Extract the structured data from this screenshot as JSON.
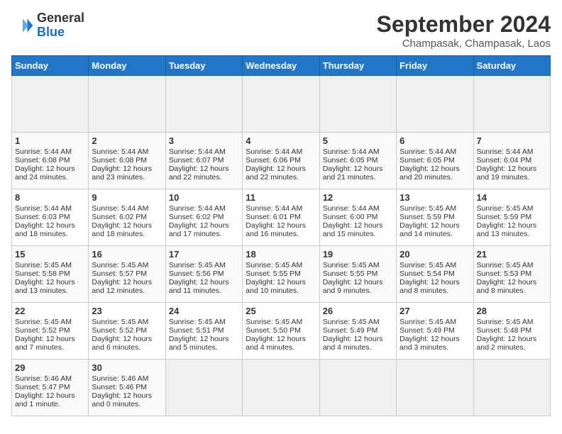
{
  "header": {
    "logo_line1": "General",
    "logo_line2": "Blue",
    "month_title": "September 2024",
    "location": "Champasak, Champasak, Laos"
  },
  "calendar": {
    "days_of_week": [
      "Sunday",
      "Monday",
      "Tuesday",
      "Wednesday",
      "Thursday",
      "Friday",
      "Saturday"
    ],
    "weeks": [
      [
        {
          "day": "",
          "empty": true
        },
        {
          "day": "",
          "empty": true
        },
        {
          "day": "",
          "empty": true
        },
        {
          "day": "",
          "empty": true
        },
        {
          "day": "",
          "empty": true
        },
        {
          "day": "",
          "empty": true
        },
        {
          "day": "",
          "empty": true
        }
      ],
      [
        {
          "day": "1",
          "sunrise": "Sunrise: 5:44 AM",
          "sunset": "Sunset: 6:08 PM",
          "daylight": "Daylight: 12 hours and 24 minutes."
        },
        {
          "day": "2",
          "sunrise": "Sunrise: 5:44 AM",
          "sunset": "Sunset: 6:08 PM",
          "daylight": "Daylight: 12 hours and 23 minutes."
        },
        {
          "day": "3",
          "sunrise": "Sunrise: 5:44 AM",
          "sunset": "Sunset: 6:07 PM",
          "daylight": "Daylight: 12 hours and 22 minutes."
        },
        {
          "day": "4",
          "sunrise": "Sunrise: 5:44 AM",
          "sunset": "Sunset: 6:06 PM",
          "daylight": "Daylight: 12 hours and 22 minutes."
        },
        {
          "day": "5",
          "sunrise": "Sunrise: 5:44 AM",
          "sunset": "Sunset: 6:05 PM",
          "daylight": "Daylight: 12 hours and 21 minutes."
        },
        {
          "day": "6",
          "sunrise": "Sunrise: 5:44 AM",
          "sunset": "Sunset: 6:05 PM",
          "daylight": "Daylight: 12 hours and 20 minutes."
        },
        {
          "day": "7",
          "sunrise": "Sunrise: 5:44 AM",
          "sunset": "Sunset: 6:04 PM",
          "daylight": "Daylight: 12 hours and 19 minutes."
        }
      ],
      [
        {
          "day": "8",
          "sunrise": "Sunrise: 5:44 AM",
          "sunset": "Sunset: 6:03 PM",
          "daylight": "Daylight: 12 hours and 18 minutes."
        },
        {
          "day": "9",
          "sunrise": "Sunrise: 5:44 AM",
          "sunset": "Sunset: 6:02 PM",
          "daylight": "Daylight: 12 hours and 18 minutes."
        },
        {
          "day": "10",
          "sunrise": "Sunrise: 5:44 AM",
          "sunset": "Sunset: 6:02 PM",
          "daylight": "Daylight: 12 hours and 17 minutes."
        },
        {
          "day": "11",
          "sunrise": "Sunrise: 5:44 AM",
          "sunset": "Sunset: 6:01 PM",
          "daylight": "Daylight: 12 hours and 16 minutes."
        },
        {
          "day": "12",
          "sunrise": "Sunrise: 5:44 AM",
          "sunset": "Sunset: 6:00 PM",
          "daylight": "Daylight: 12 hours and 15 minutes."
        },
        {
          "day": "13",
          "sunrise": "Sunrise: 5:45 AM",
          "sunset": "Sunset: 5:59 PM",
          "daylight": "Daylight: 12 hours and 14 minutes."
        },
        {
          "day": "14",
          "sunrise": "Sunrise: 5:45 AM",
          "sunset": "Sunset: 5:59 PM",
          "daylight": "Daylight: 12 hours and 13 minutes."
        }
      ],
      [
        {
          "day": "15",
          "sunrise": "Sunrise: 5:45 AM",
          "sunset": "Sunset: 5:58 PM",
          "daylight": "Daylight: 12 hours and 13 minutes."
        },
        {
          "day": "16",
          "sunrise": "Sunrise: 5:45 AM",
          "sunset": "Sunset: 5:57 PM",
          "daylight": "Daylight: 12 hours and 12 minutes."
        },
        {
          "day": "17",
          "sunrise": "Sunrise: 5:45 AM",
          "sunset": "Sunset: 5:56 PM",
          "daylight": "Daylight: 12 hours and 11 minutes."
        },
        {
          "day": "18",
          "sunrise": "Sunrise: 5:45 AM",
          "sunset": "Sunset: 5:55 PM",
          "daylight": "Daylight: 12 hours and 10 minutes."
        },
        {
          "day": "19",
          "sunrise": "Sunrise: 5:45 AM",
          "sunset": "Sunset: 5:55 PM",
          "daylight": "Daylight: 12 hours and 9 minutes."
        },
        {
          "day": "20",
          "sunrise": "Sunrise: 5:45 AM",
          "sunset": "Sunset: 5:54 PM",
          "daylight": "Daylight: 12 hours and 8 minutes."
        },
        {
          "day": "21",
          "sunrise": "Sunrise: 5:45 AM",
          "sunset": "Sunset: 5:53 PM",
          "daylight": "Daylight: 12 hours and 8 minutes."
        }
      ],
      [
        {
          "day": "22",
          "sunrise": "Sunrise: 5:45 AM",
          "sunset": "Sunset: 5:52 PM",
          "daylight": "Daylight: 12 hours and 7 minutes."
        },
        {
          "day": "23",
          "sunrise": "Sunrise: 5:45 AM",
          "sunset": "Sunset: 5:52 PM",
          "daylight": "Daylight: 12 hours and 6 minutes."
        },
        {
          "day": "24",
          "sunrise": "Sunrise: 5:45 AM",
          "sunset": "Sunset: 5:51 PM",
          "daylight": "Daylight: 12 hours and 5 minutes."
        },
        {
          "day": "25",
          "sunrise": "Sunrise: 5:45 AM",
          "sunset": "Sunset: 5:50 PM",
          "daylight": "Daylight: 12 hours and 4 minutes."
        },
        {
          "day": "26",
          "sunrise": "Sunrise: 5:45 AM",
          "sunset": "Sunset: 5:49 PM",
          "daylight": "Daylight: 12 hours and 4 minutes."
        },
        {
          "day": "27",
          "sunrise": "Sunrise: 5:45 AM",
          "sunset": "Sunset: 5:49 PM",
          "daylight": "Daylight: 12 hours and 3 minutes."
        },
        {
          "day": "28",
          "sunrise": "Sunrise: 5:45 AM",
          "sunset": "Sunset: 5:48 PM",
          "daylight": "Daylight: 12 hours and 2 minutes."
        }
      ],
      [
        {
          "day": "29",
          "sunrise": "Sunrise: 5:46 AM",
          "sunset": "Sunset: 5:47 PM",
          "daylight": "Daylight: 12 hours and 1 minute."
        },
        {
          "day": "30",
          "sunrise": "Sunrise: 5:46 AM",
          "sunset": "Sunset: 5:46 PM",
          "daylight": "Daylight: 12 hours and 0 minutes."
        },
        {
          "day": "",
          "empty": true
        },
        {
          "day": "",
          "empty": true
        },
        {
          "day": "",
          "empty": true
        },
        {
          "day": "",
          "empty": true
        },
        {
          "day": "",
          "empty": true
        }
      ]
    ]
  }
}
